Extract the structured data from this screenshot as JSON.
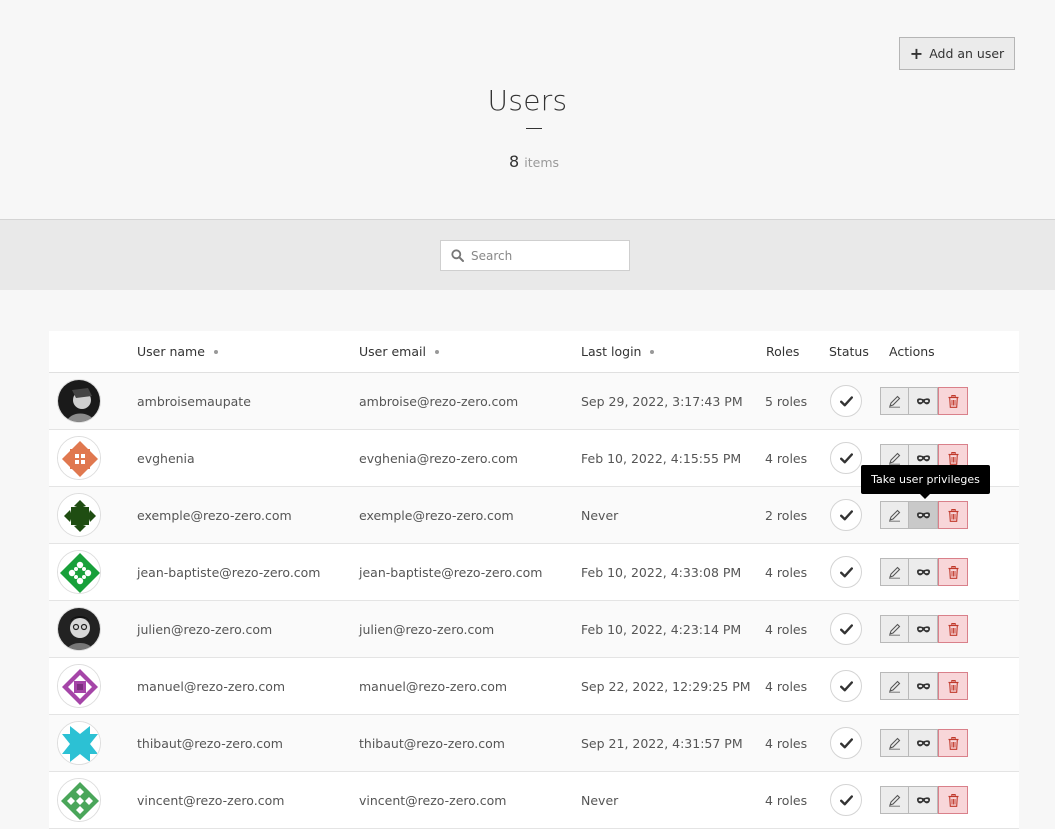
{
  "header": {
    "add_button_label": "Add an user",
    "title": "Users",
    "count_number": "8",
    "count_label": "items"
  },
  "search": {
    "placeholder": "Search"
  },
  "table": {
    "columns": {
      "user_name": "User name",
      "user_email": "User email",
      "last_login": "Last login",
      "roles": "Roles",
      "status": "Status",
      "actions": "Actions"
    },
    "rows": [
      {
        "name": "ambroisemaupate",
        "email": "ambroise@rezo-zero.com",
        "last_login": "Sep 29, 2022, 3:17:43 PM",
        "roles": "5 roles"
      },
      {
        "name": "evghenia",
        "email": "evghenia@rezo-zero.com",
        "last_login": "Feb 10, 2022, 4:15:55 PM",
        "roles": "4 roles"
      },
      {
        "name": "exemple@rezo-zero.com",
        "email": "exemple@rezo-zero.com",
        "last_login": "Never",
        "roles": "2 roles"
      },
      {
        "name": "jean-baptiste@rezo-zero.com",
        "email": "jean-baptiste@rezo-zero.com",
        "last_login": "Feb 10, 2022, 4:33:08 PM",
        "roles": "4 roles"
      },
      {
        "name": "julien@rezo-zero.com",
        "email": "julien@rezo-zero.com",
        "last_login": "Feb 10, 2022, 4:23:14 PM",
        "roles": "4 roles"
      },
      {
        "name": "manuel@rezo-zero.com",
        "email": "manuel@rezo-zero.com",
        "last_login": "Sep 22, 2022, 12:29:25 PM",
        "roles": "4 roles"
      },
      {
        "name": "thibaut@rezo-zero.com",
        "email": "thibaut@rezo-zero.com",
        "last_login": "Sep 21, 2022, 4:31:57 PM",
        "roles": "4 roles"
      },
      {
        "name": "vincent@rezo-zero.com",
        "email": "vincent@rezo-zero.com",
        "last_login": "Never",
        "roles": "4 roles"
      }
    ]
  },
  "tooltip": {
    "text": "Take user privileges"
  },
  "icons": {
    "add": "plus-icon",
    "search": "search-icon",
    "status": "check-icon",
    "edit": "pencil-icon",
    "take_privileges": "mask-icon",
    "delete": "trash-icon"
  }
}
